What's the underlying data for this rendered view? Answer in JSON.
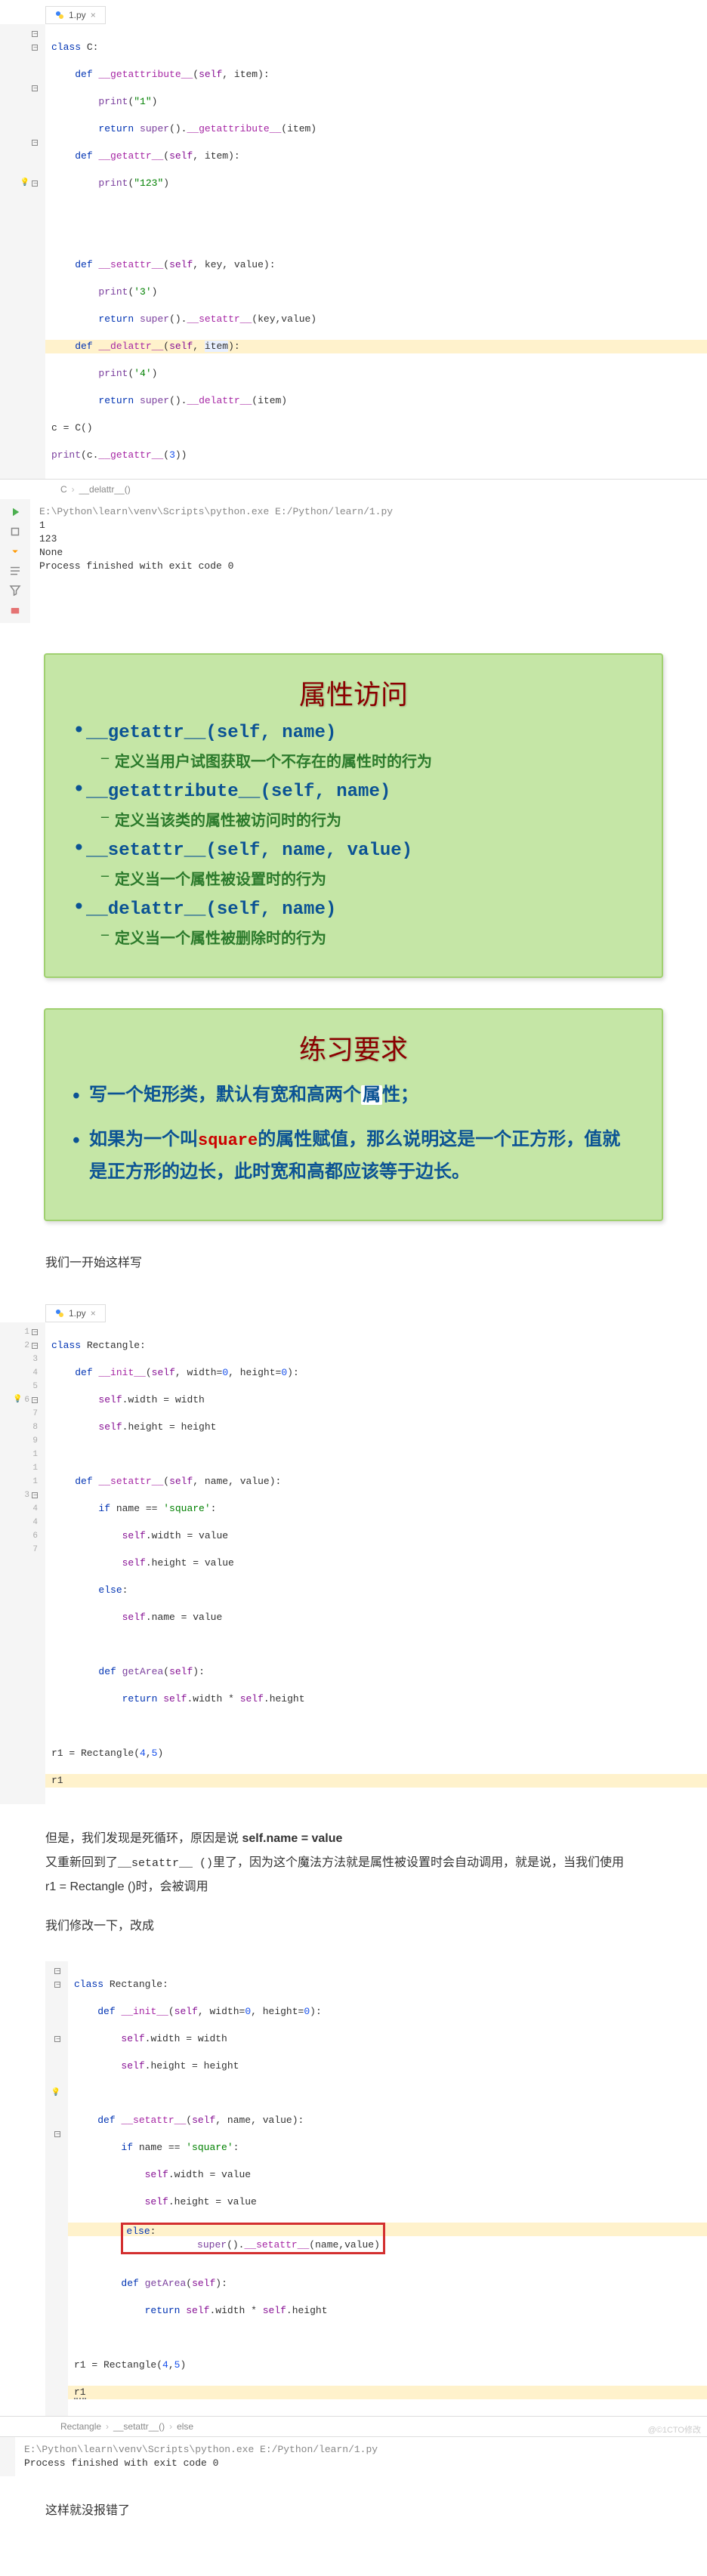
{
  "tab1": {
    "name": "1.py"
  },
  "code1": {
    "l1": "class C:",
    "l2": "    def __getattribute__(self, item):",
    "l3": "        print(\"1\")",
    "l4": "        return super().__getattribute__(item)",
    "l5": "    def __getattr__(self, item):",
    "l6": "        print(\"123\")",
    "l7": "",
    "l8": "",
    "l9": "    def __setattr__(self, key, value):",
    "l10": "        print('3')",
    "l11": "        return super().__setattr__(key,value)",
    "l12": "    def __delattr__(self, item):",
    "l13": "        print('4')",
    "l14": "        return super().__delattr__(item)",
    "l15": "c = C()",
    "l16": "print(c.__getattr__(3))"
  },
  "bc1": {
    "a": "C",
    "b": "__delattr__()"
  },
  "con1": {
    "cmd": "E:\\Python\\learn\\venv\\Scripts\\python.exe E:/Python/learn/1.py",
    "o1": "1",
    "o2": "123",
    "o3": "None",
    "end": "Process finished with exit code 0"
  },
  "slide1": {
    "title": "属性访问",
    "i1": "__getattr__(self, name)",
    "d1": "定义当用户试图获取一个不存在的属性时的行为",
    "i2": "__getattribute__(self, name)",
    "d2": "定义当该类的属性被访问时的行为",
    "i3": "__setattr__(self, name, value)",
    "d3": "定义当一个属性被设置时的行为",
    "i4": "__delattr__(self, name)",
    "d4": "定义当一个属性被删除时的行为"
  },
  "slide2": {
    "title": "练习要求",
    "i1a": "写一个矩形类，默认有宽和高两个",
    "i1b": "属",
    "i1c": "性；",
    "i2a": "如果为一个叫",
    "i2b": "square",
    "i2c": "的属性赋值，那么说明这是一个正方形，值就是正方形的边长，此时宽和高都应该等于边长。"
  },
  "h2": "我们一开始这样写",
  "code2": {
    "l1": "class Rectangle:",
    "l2": "    def __init__(self, width=0, height=0):",
    "l3": "        self.width = width",
    "l4": "        self.height = height",
    "l5": "",
    "l6": "    def __setattr__(self, name, value):",
    "l7": "        if name == 'square':",
    "l8": "            self.width = value",
    "l9": "            self.height = value",
    "l10": "        else:",
    "l11": "            self.name = value",
    "l12": "",
    "l13": "        def getArea(self):",
    "l14": "            return self.width * self.height",
    "l15": "",
    "l16": "r1 = Rectangle(4,5)",
    "l17": "r1"
  },
  "ln2": [
    "1",
    "2",
    "3",
    "4",
    "5",
    "6",
    "7",
    "8",
    "9",
    "1 ",
    "1",
    "1 ",
    "3",
    "4",
    "4",
    "6",
    "7"
  ],
  "p3": {
    "a": "但是，我们发现是死循环，原因是说 ",
    "b": "self.name = value"
  },
  "p4": {
    "a": "又重新回到了",
    "b": "__setattr__ ()",
    "c": "里了，因为这个魔法方法就是属性被设置时会自动调用，就是说，当我们使用",
    "d": "r1 = Rectangle ()",
    "e": "时，会被调用"
  },
  "p5": "我们修改一下，改成",
  "code3": {
    "l1": "class Rectangle:",
    "l2": "    def __init__(self, width=0, height=0):",
    "l3": "        self.width = width",
    "l4": "        self.height = height",
    "l5": "",
    "l6": "    def __setattr__(self, name, value):",
    "l7": "        if name == 'square':",
    "l8": "            self.width = value",
    "l9": "            self.height = value",
    "l10": "        else:",
    "l11": "            super().__setattr__(name,value)",
    "l12": "",
    "l13": "        def getArea(self):",
    "l14": "            return self.width * self.height",
    "l15": "",
    "l16": "r1 = Rectangle(4,5)",
    "l17": "r1"
  },
  "bc3": {
    "a": "Rectangle",
    "b": "__setattr__()",
    "c": "else"
  },
  "con3": {
    "cmd": "E:\\Python\\learn\\venv\\Scripts\\python.exe E:/Python/learn/1.py",
    "end": "Process finished with exit code 0"
  },
  "p6": "这样就没报错了",
  "wm": "@©1CTO修改"
}
